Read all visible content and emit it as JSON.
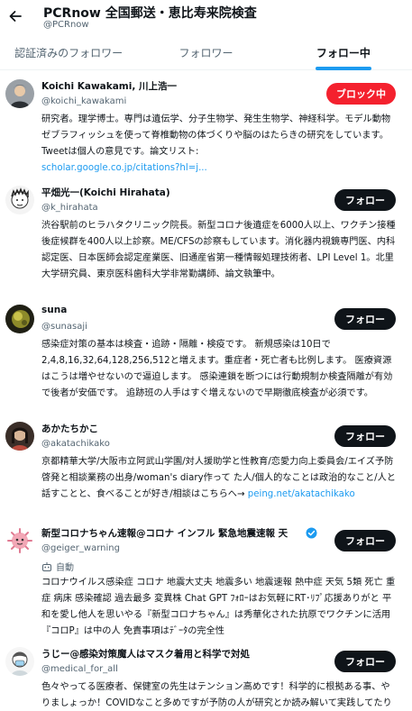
{
  "header": {
    "title": "PCRnow 全国郵送・恵比寿来院検査",
    "handle": "@PCRnow"
  },
  "tabs": [
    {
      "label": "認証済みのフォロワー"
    },
    {
      "label": "フォロワー"
    },
    {
      "label": "フォロー中"
    }
  ],
  "users": [
    {
      "name": "Koichi Kawakami, 川上浩一",
      "handle": "@koichi_kawakami",
      "button": "ブロック中",
      "bio": "研究者。理学博士。専門は遺伝学、分子生物学、発生生物学、神経科学。モデル動物ゼブラフィッシュを使って脊椎動物の体づくりや脳のはたらきの研究をしています。Tweetは個人の意見です。論文リスト:",
      "link": "scholar.google.co.jp/citations?hl=j..."
    },
    {
      "name": "平畑光一(Koichi Hirahata)",
      "handle": "@k_hirahata",
      "button": "フォロー",
      "bio": "渋谷駅前のヒラハタクリニック院長。新型コロナ後遺症を6000人以上、ワクチン接種後症候群を400人以上診察。ME/CFSの診察もしています。消化器内視鏡専門医、内科認定医、日本医師会認定産業医、旧通産省第一種情報処理技術者、LPI Level 1。北里大学研究員、東京医科歯科大学非常勤講師、論文執筆中。"
    },
    {
      "name": "suna",
      "handle": "@sunasaji",
      "button": "フォロー",
      "bio": "感染症対策の基本は検査・追跡・隔離・検疫です。 新規感染は10日で2,4,8,16,32,64,128,256,512と増えます。重症者・死亡者も比例します。 医療資源はこうは増やせないので逼迫します。 感染連鎖を断つには行動規制か検査隔離が有効で後者が安価です。 追跡班の人手はすぐ増えないので早期徹底検査が必須です。"
    },
    {
      "name": "あかたちかこ",
      "handle": "@akatachikako",
      "button": "フォロー",
      "bio": "京都精華大学/大阪市立阿武山学園/対人援助学と性教育/恋愛力向上委員会/エイズ予防啓発と相談業務の出身/woman's diary作って た人/個人的なことは政治的なこと/人と話すことと、食べることが好き/相談はこちらへ→",
      "link": "peing.net/akatachikako"
    },
    {
      "name": "新型コロナちゃん速報@コロナ インフル 緊急地震速報 天",
      "handle": "@geiger_warning",
      "button": "フォロー",
      "sub": "自動",
      "bio": "コロナウイルス感染症 コロナ 地震大丈夫 地震多い 地震速報 熱中症 天気 5類 死亡 重症 病床 感染確認 過去最多 変異株 Chat GPT ﾌｫﾛｰはお気軽にRT･ﾘﾌﾟ応援ありがと 平和を愛し他人を思いやる『新型コロナちゃん』は秀華化された抗原でワクチンに活用 『コロP』は中の人 免責事項はﾃﾞｰﾀの完全性"
    },
    {
      "name": "うじー@感染対策魔人はマスク着用と科学で対処",
      "handle": "@medical_for_all",
      "button": "フォロー",
      "bio": "色々やってる医療者、保健室の先生はテンション高めです！科学的に根拠ある事、やりましょっか！COVIDなこと多めですが予防の人が研究とか読み解いて実践してたりします！反コロナ反マスクの非科学的な人は お断りで"
    }
  ],
  "colors": {
    "accent": "#1d9bf0",
    "block": "#f4212e",
    "follow_button": "#0f1419"
  },
  "icons": {
    "back": "arrow-left-icon",
    "verified": "verified-badge-icon",
    "bot": "robot-icon"
  }
}
